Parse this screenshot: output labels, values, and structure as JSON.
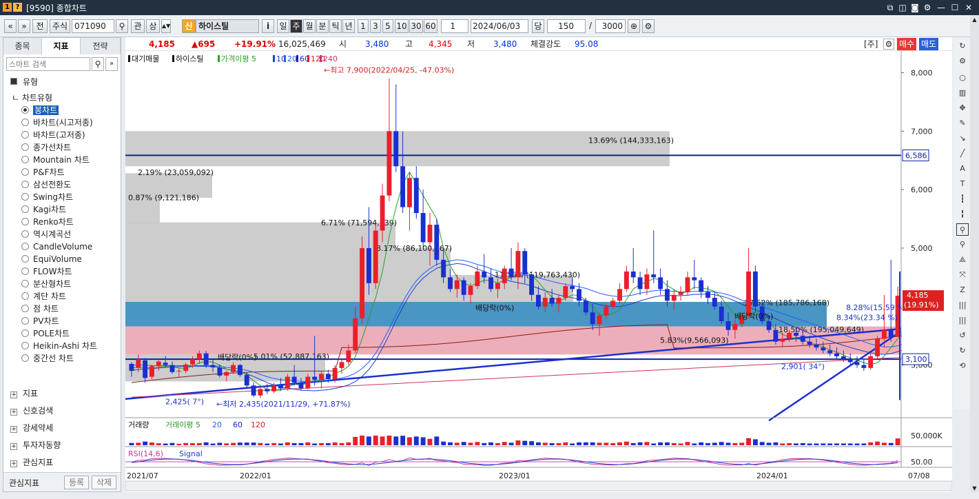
{
  "window": {
    "title": "[9590] 종합차트",
    "icon1": "1",
    "icon2": "?",
    "buttons": [
      "restore",
      "fav",
      "settings",
      "min",
      "max",
      "close"
    ]
  },
  "toolbar": {
    "nav_left": "«",
    "nav_down": "»",
    "jeon": "전",
    "type": "주식",
    "code": "071090",
    "lock_icon": "search-icon",
    "gwan": "관",
    "sang": "상",
    "sin": "신",
    "name": "하이스틸",
    "info": "i",
    "periods": [
      "일",
      "주",
      "월",
      "분",
      "틱",
      "년"
    ],
    "active_period": "주",
    "nums": [
      "1",
      "3",
      "5",
      "10",
      "30",
      "60"
    ],
    "interval": "1",
    "date": "2024/06/03",
    "dang": "당",
    "count": "150",
    "slash": "/",
    "max": "3000"
  },
  "left": {
    "tabs": [
      "종목",
      "지표",
      "전략"
    ],
    "active_tab": "지표",
    "search_placeholder": "스마트 검색",
    "section": "유형",
    "subsection": "차트유형",
    "types": [
      "봉차트",
      "바차트(시고저종)",
      "바차트(고저종)",
      "종가선차트",
      "Mountain 차트",
      "P&F차트",
      "삼선전환도",
      "Swing차트",
      "Kagi차트",
      "Renko차트",
      "역시계곡선",
      "CandleVolume",
      "EquiVolume",
      "FLOW차트",
      "분산형차트",
      "계단 차트",
      "점 차트",
      "PV차트",
      "POLE차트",
      "Heikin-Ashi 차트",
      "중간선 차트"
    ],
    "selected": "봉차트",
    "bottom_sections": [
      "지표",
      "신호검색",
      "강세약세",
      "투자자동향",
      "관심지표"
    ],
    "footer_label": "관심지표",
    "register": "등록",
    "delete": "삭제"
  },
  "info": {
    "price": "4,185",
    "change": "▲695",
    "rate": "+19.91%",
    "volume": "16,025,469",
    "o_label": "시",
    "open": "3,480",
    "h_label": "고",
    "high": "4,345",
    "l_label": "저",
    "low": "3,480",
    "strength_label": "체결강도",
    "strength": "95.08",
    "ju": "[주]",
    "buy": "매수",
    "sell": "매도"
  },
  "legend": {
    "items": [
      "대기매물",
      "하이스틸",
      "가격이평 5",
      "10",
      "20",
      "60",
      "120",
      "240"
    ],
    "colors": {
      "c5": "#2a9d2a",
      "c10": "#1a3fcc",
      "c20": "#2060ff",
      "c60": "#1a1acc",
      "c120": "#cc2222",
      "c240": "#cc3366"
    }
  },
  "annotations": {
    "high": "←최고 7,900(2022/04/25, -47.03%)",
    "low": "←최저 2,435(2021/11/29, +71.87%)",
    "line1": "2,425( 7°)",
    "line2": "2,901( 34°)",
    "div1": "배당락(0%)",
    "div2": "배당락(0%)",
    "div3": "배당락(0%)",
    "pct1": "5.83%(9,566,093)",
    "pct2": "8.28%(15.59 %)",
    "pct3": "8.34%(23.34 %)",
    "h6586": "6,586",
    "h3100": "3,100"
  },
  "zones": [
    {
      "label": "13.69% (144,333,163)"
    },
    {
      "label": "2.19% (23,059,092)"
    },
    {
      "label": "0.87% (9,121,186)"
    },
    {
      "label": "6.71% (71,594,139)"
    },
    {
      "label": "8.17% (86,100,067)"
    },
    {
      "label": "11.36% (119,763,430)"
    },
    {
      "label": "17.62% (185,786,168)"
    },
    {
      "label": "18.50% (195,049,649)"
    },
    {
      "label": "5.01% (52,887,163)"
    }
  ],
  "yaxis": {
    "ticks": [
      "8,000",
      "7,000",
      "6,000",
      "5,000",
      "3,000"
    ],
    "price_tag": "4,185",
    "price_pct": "(19.91%)"
  },
  "volume": {
    "title": "거래량",
    "ma": "거래이평 5",
    "m20": "20",
    "m60": "60",
    "m120": "120",
    "tick": "50,000K"
  },
  "rsi": {
    "title": "RSI(14,6)",
    "signal": "Signal",
    "tick": "50.00"
  },
  "xaxis": {
    "labels": [
      "2021/07",
      "2022/01",
      "2023/01",
      "2024/01",
      "07/08"
    ]
  },
  "chart_data": {
    "type": "candlestick",
    "ylim": [
      2100,
      8300
    ],
    "candles": [
      [
        3020,
        3050,
        2800,
        2900
      ],
      [
        2950,
        3180,
        2880,
        3100
      ],
      [
        3080,
        3120,
        2700,
        2780
      ],
      [
        2800,
        3010,
        2760,
        2980
      ],
      [
        2980,
        3100,
        2900,
        3060
      ],
      [
        3040,
        3150,
        2960,
        3000
      ],
      [
        3000,
        3060,
        2850,
        2880
      ],
      [
        2890,
        2950,
        2780,
        2900
      ],
      [
        2900,
        3040,
        2860,
        3010
      ],
      [
        3010,
        3150,
        2950,
        3100
      ],
      [
        3100,
        3250,
        3020,
        3200
      ],
      [
        3200,
        3240,
        2950,
        3000
      ],
      [
        3000,
        3090,
        2880,
        2960
      ],
      [
        2960,
        3010,
        2790,
        2820
      ],
      [
        2820,
        2900,
        2720,
        2880
      ],
      [
        2880,
        3050,
        2850,
        3000
      ],
      [
        3000,
        3020,
        2800,
        2830
      ],
      [
        2830,
        2870,
        2600,
        2650
      ],
      [
        2650,
        2700,
        2450,
        2480
      ],
      [
        2480,
        2620,
        2435,
        2590
      ],
      [
        2590,
        2680,
        2500,
        2550
      ],
      [
        2550,
        2700,
        2520,
        2650
      ],
      [
        2650,
        2780,
        2560,
        2600
      ],
      [
        2600,
        2850,
        2560,
        2800
      ],
      [
        2800,
        3000,
        2650,
        2700
      ],
      [
        2700,
        2780,
        2560,
        2600
      ],
      [
        2600,
        2850,
        2580,
        2800
      ],
      [
        2800,
        3500,
        2650,
        2750
      ],
      [
        2750,
        2900,
        2600,
        2850
      ],
      [
        2850,
        2920,
        2700,
        2760
      ],
      [
        2760,
        3000,
        2700,
        2950
      ],
      [
        2950,
        3100,
        2850,
        3050
      ],
      [
        3050,
        3350,
        3000,
        3250
      ],
      [
        3250,
        4000,
        3200,
        3800
      ],
      [
        3800,
        5200,
        3700,
        5000
      ],
      [
        5000,
        5700,
        4200,
        4400
      ],
      [
        4400,
        5400,
        4300,
        5300
      ],
      [
        5300,
        6100,
        5100,
        5900
      ],
      [
        5900,
        7900,
        5800,
        7000
      ],
      [
        7000,
        7800,
        6300,
        6400
      ],
      [
        6400,
        7000,
        5600,
        5700
      ],
      [
        5700,
        6300,
        5300,
        6200
      ],
      [
        6200,
        6400,
        5500,
        5600
      ],
      [
        5600,
        6000,
        5000,
        5100
      ],
      [
        5100,
        5600,
        4700,
        5400
      ],
      [
        5400,
        5500,
        4700,
        4800
      ],
      [
        4800,
        5000,
        4400,
        4500
      ],
      [
        4500,
        4650,
        4250,
        4300
      ],
      [
        4300,
        4550,
        4150,
        4450
      ],
      [
        4450,
        4500,
        4100,
        4200
      ],
      [
        4200,
        4400,
        4050,
        4350
      ],
      [
        4350,
        4700,
        4300,
        4600
      ],
      [
        4600,
        4900,
        4400,
        4500
      ],
      [
        4500,
        4650,
        4250,
        4300
      ],
      [
        4300,
        4500,
        4150,
        4400
      ],
      [
        4400,
        4700,
        4300,
        4650
      ],
      [
        4650,
        5000,
        4450,
        4500
      ],
      [
        4500,
        5100,
        4300,
        4950
      ],
      [
        4950,
        5000,
        4400,
        4550
      ],
      [
        4550,
        4600,
        4100,
        4200
      ],
      [
        4200,
        4350,
        3950,
        4000
      ],
      [
        4000,
        4250,
        3900,
        4150
      ],
      [
        4150,
        4300,
        4000,
        4050
      ],
      [
        4050,
        4200,
        3900,
        4150
      ],
      [
        4150,
        4400,
        4100,
        4350
      ],
      [
        4350,
        4500,
        4250,
        4300
      ],
      [
        4300,
        4400,
        4000,
        4100
      ],
      [
        4100,
        4150,
        3850,
        3900
      ],
      [
        3900,
        4050,
        3600,
        3700
      ],
      [
        3700,
        3900,
        3500,
        3850
      ],
      [
        3850,
        4050,
        3800,
        4000
      ],
      [
        4000,
        4150,
        3950,
        4100
      ],
      [
        4100,
        4400,
        4050,
        4300
      ],
      [
        4300,
        4700,
        4250,
        4600
      ],
      [
        4600,
        5000,
        4400,
        4500
      ],
      [
        4500,
        4600,
        4200,
        4300
      ],
      [
        4300,
        4650,
        4200,
        4550
      ],
      [
        4550,
        5300,
        4400,
        4500
      ],
      [
        4500,
        4650,
        4200,
        4300
      ],
      [
        4300,
        4450,
        4000,
        4100
      ],
      [
        4100,
        4300,
        3950,
        4200
      ],
      [
        4200,
        4350,
        4100,
        4250
      ],
      [
        4250,
        4600,
        4200,
        4500
      ],
      [
        4500,
        4800,
        4300,
        4450
      ],
      [
        4450,
        4500,
        4150,
        4250
      ],
      [
        4250,
        4350,
        4050,
        4150
      ],
      [
        4150,
        4250,
        3950,
        4000
      ],
      [
        4000,
        4100,
        3700,
        3750
      ],
      [
        3750,
        3900,
        3500,
        3600
      ],
      [
        3600,
        3800,
        3450,
        3700
      ],
      [
        3700,
        3900,
        3650,
        3850
      ],
      [
        3850,
        5000,
        3800,
        4600
      ],
      [
        4600,
        4700,
        3900,
        4000
      ],
      [
        4000,
        4100,
        3700,
        3750
      ],
      [
        3750,
        3850,
        3550,
        3600
      ],
      [
        3600,
        3700,
        3350,
        3400
      ],
      [
        3400,
        3550,
        3300,
        3450
      ],
      [
        3450,
        3600,
        3400,
        3550
      ],
      [
        3550,
        3650,
        3400,
        3500
      ],
      [
        3500,
        3600,
        3350,
        3400
      ],
      [
        3400,
        3500,
        3300,
        3350
      ],
      [
        3350,
        3450,
        3250,
        3300
      ],
      [
        3300,
        3400,
        3200,
        3250
      ],
      [
        3250,
        3350,
        3150,
        3200
      ],
      [
        3200,
        3300,
        3100,
        3150
      ],
      [
        3150,
        3250,
        3050,
        3100
      ],
      [
        3100,
        3200,
        3000,
        3050
      ],
      [
        3050,
        3150,
        2950,
        3000
      ],
      [
        3000,
        3100,
        2901,
        2950
      ],
      [
        2950,
        3200,
        2920,
        3150
      ],
      [
        3150,
        3500,
        3100,
        3450
      ],
      [
        3450,
        4200,
        3300,
        3600
      ],
      [
        3600,
        4800,
        3400,
        3480
      ],
      [
        3480,
        4345,
        3480,
        4185
      ]
    ],
    "ma5": [
      2950,
      2960,
      2960,
      2950,
      2960,
      2980,
      2970,
      2950,
      2940,
      2980,
      3040,
      3060,
      3050,
      3000,
      2930,
      2900,
      2900,
      2830,
      2730,
      2650,
      2580,
      2570,
      2570,
      2620,
      2670,
      2660,
      2690,
      2740,
      2740,
      2780,
      2860,
      2900,
      2980,
      3140,
      3450,
      3800,
      4150,
      4600,
      5200,
      5700,
      6100,
      6300,
      6100,
      5900,
      5700,
      5500,
      5000,
      4700,
      4500,
      4400,
      4350,
      4400,
      4450,
      4450,
      4400,
      4450,
      4500,
      4560,
      4580,
      4540,
      4420,
      4280,
      4160,
      4100,
      4140,
      4200,
      4190,
      4110,
      3990,
      3860,
      3850,
      3880,
      3950,
      4120,
      4300,
      4380,
      4420,
      4480,
      4460,
      4360,
      4290,
      4220,
      4260,
      4330,
      4320,
      4300,
      4260,
      4150,
      4000,
      3850,
      3800,
      3860,
      3900,
      3830,
      3740,
      3600,
      3520,
      3480,
      3450,
      3430,
      3390,
      3350,
      3310,
      3260,
      3220,
      3170,
      3120,
      3080,
      3040,
      3010,
      3040,
      3150,
      3300,
      3450,
      3600,
      3800
    ],
    "ma20": [
      3000,
      3000,
      3000,
      2990,
      2990,
      2990,
      2990,
      2990,
      2990,
      2990,
      2990,
      2990,
      2990,
      2980,
      2960,
      2950,
      2930,
      2910,
      2880,
      2840,
      2800,
      2770,
      2750,
      2740,
      2730,
      2720,
      2720,
      2720,
      2730,
      2740,
      2760,
      2780,
      2810,
      2860,
      2940,
      3050,
      3200,
      3400,
      3620,
      3860,
      4080,
      4280,
      4440,
      4560,
      4650,
      4720,
      4760,
      4780,
      4800,
      4790,
      4760,
      4720,
      4690,
      4650,
      4610,
      4580,
      4560,
      4550,
      4540,
      4520,
      4490,
      4460,
      4430,
      4400,
      4380,
      4360,
      4340,
      4310,
      4270,
      4230,
      4200,
      4180,
      4170,
      4180,
      4200,
      4230,
      4250,
      4270,
      4280,
      4270,
      4260,
      4250,
      4250,
      4260,
      4260,
      4260,
      4250,
      4230,
      4200,
      4160,
      4110,
      4070,
      4040,
      4000,
      3960,
      3920,
      3880,
      3840,
      3800,
      3760,
      3720,
      3680,
      3640,
      3600,
      3560,
      3520,
      3480,
      3440,
      3400,
      3360,
      3330,
      3310,
      3310,
      3330,
      3360,
      3400
    ]
  }
}
